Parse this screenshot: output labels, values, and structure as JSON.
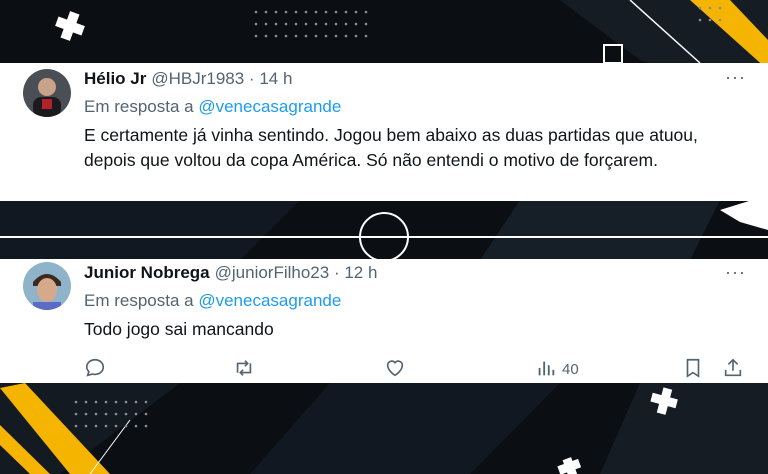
{
  "colors": {
    "background": "#0b0f14",
    "accent_yellow": "#f5b400",
    "link_blue": "#1d9bf0",
    "muted_gray": "#536471",
    "text_black": "#0f1419"
  },
  "tweets": [
    {
      "display_name": "Hélio Jr",
      "handle_meta": "@HBJr1983 · 14 h",
      "reply_prefix": "Em resposta a",
      "reply_mention": "@venecasagrande",
      "text": "E certamente já vinha sentindo. Jogou bem abaixo as duas partidas que atuou, depois que voltou da copa América. Só não entendi o motivo de forçarem.",
      "more_icon": "more-dots-icon"
    },
    {
      "display_name": "Junior Nobrega",
      "handle_meta": "@juniorFilho23 · 12 h",
      "reply_prefix": "Em resposta a",
      "reply_mention": "@venecasagrande",
      "text": "Todo jogo sai mancando",
      "more_icon": "more-dots-icon",
      "actions": {
        "reply_icon": "reply-icon",
        "retweet_icon": "retweet-icon",
        "like_icon": "heart-icon",
        "views_icon": "views-chart-icon",
        "views_count": "40",
        "bookmark_icon": "bookmark-icon",
        "share_icon": "share-icon"
      }
    }
  ]
}
